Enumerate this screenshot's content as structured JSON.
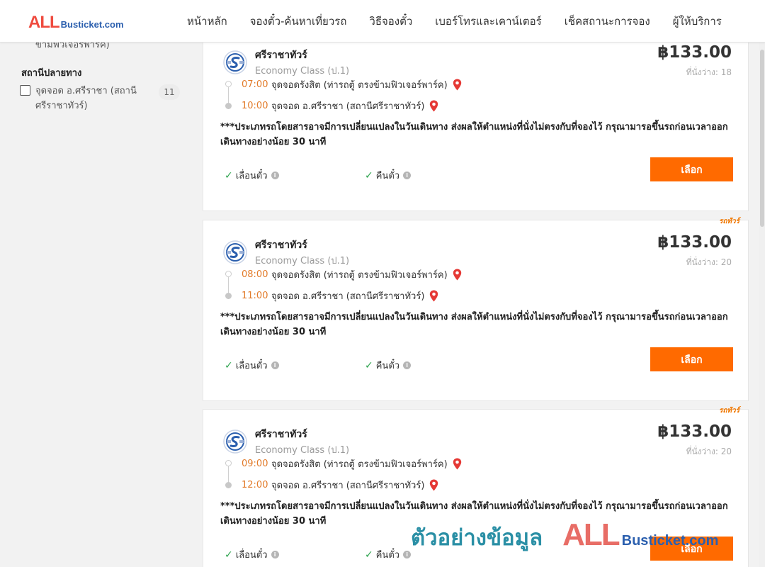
{
  "header": {
    "logo_all": "ALL",
    "logo_rest": "Busticket.com",
    "nav": [
      "หน้าหลัก",
      "จองตั๋ว-ค้นหาเที่ยวรถ",
      "วิธีจองตั๋ว",
      "เบอร์โทรและเคาน์เตอร์",
      "เช็คสถานะการจอง",
      "ผู้ให้บริการ"
    ]
  },
  "sidebar": {
    "cut_text": "ข้ามฟิวเจอร์พาร์ค)",
    "section_title": "สถานีปลายทาง",
    "filter_label": "จุดจอด อ.ศรีราชา (สถานีศรีราชาทัวร์)",
    "filter_count": "11"
  },
  "trips": [
    {
      "company": "ศรีราชาทัวร์",
      "class": "Economy Class (ป.1)",
      "price": "฿133.00",
      "seats": "ที่นั่งว่าง: 18",
      "tag": "",
      "dep_time": "07:00",
      "dep_place": "จุดจอดรังสิต (ท่ารถตู้ ตรงข้ามฟิวเจอร์พาร์ค)",
      "arr_time": "10:00",
      "arr_place": "จุดจอด อ.ศรีราชา (สถานีศรีราชาทัวร์)",
      "notice": "***ประเภทรถโดยสารอาจมีการเปลี่ยนแปลงในวันเดินทาง ส่งผลให้ตำแหน่งที่นั่งไม่ตรงกับที่จองไว้ กรุณามารอขึ้นรถก่อนเวลาออกเดินทางอย่างน้อย 30 นาที",
      "feature1": "เลื่อนตั๋ว",
      "feature2": "คืนตั๋ว",
      "button": "เลือก"
    },
    {
      "company": "ศรีราชาทัวร์",
      "class": "Economy Class (ป.1)",
      "price": "฿133.00",
      "seats": "ที่นั่งว่าง: 20",
      "tag": "รถทัวร์",
      "dep_time": "08:00",
      "dep_place": "จุดจอดรังสิต (ท่ารถตู้ ตรงข้ามฟิวเจอร์พาร์ค)",
      "arr_time": "11:00",
      "arr_place": "จุดจอด อ.ศรีราชา (สถานีศรีราชาทัวร์)",
      "notice": "***ประเภทรถโดยสารอาจมีการเปลี่ยนแปลงในวันเดินทาง ส่งผลให้ตำแหน่งที่นั่งไม่ตรงกับที่จองไว้ กรุณามารอขึ้นรถก่อนเวลาออกเดินทางอย่างน้อย 30 นาที",
      "feature1": "เลื่อนตั๋ว",
      "feature2": "คืนตั๋ว",
      "button": "เลือก"
    },
    {
      "company": "ศรีราชาทัวร์",
      "class": "Economy Class (ป.1)",
      "price": "฿133.00",
      "seats": "ที่นั่งว่าง: 20",
      "tag": "รถทัวร์",
      "dep_time": "09:00",
      "dep_place": "จุดจอดรังสิต (ท่ารถตู้ ตรงข้ามฟิวเจอร์พาร์ค)",
      "arr_time": "12:00",
      "arr_place": "จุดจอด อ.ศรีราชา (สถานีศรีราชาทัวร์)",
      "notice": "***ประเภทรถโดยสารอาจมีการเปลี่ยนแปลงในวันเดินทาง ส่งผลให้ตำแหน่งที่นั่งไม่ตรงกับที่จองไว้ กรุณามารอขึ้นรถก่อนเวลาออกเดินทางอย่างน้อย 30 นาที",
      "feature1": "เลื่อนตั๋ว",
      "feature2": "คืนตั๋ว",
      "button": "เลือก"
    }
  ],
  "watermark": {
    "thai": "ตัวอย่างข้อมูล",
    "all": "ALL",
    "rest": "Busticket.com"
  },
  "colors": {
    "accent": "#ff6a00",
    "time": "#e27b2a",
    "check": "#2ea44f",
    "pin": "#e53935",
    "logo_red": "#ef4b3f",
    "logo_blue": "#2b5fae"
  },
  "icons": {
    "company_logo": "company-logo-icon",
    "pin": "map-pin-icon",
    "check": "check-icon",
    "info": "info-icon"
  }
}
